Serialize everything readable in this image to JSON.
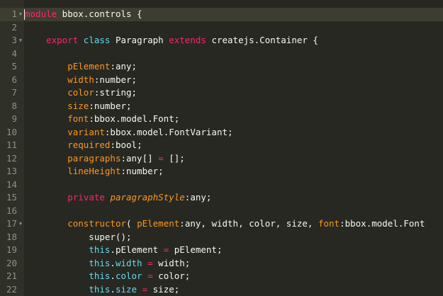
{
  "editor": {
    "lines": [
      {
        "num": "1",
        "fold": true,
        "active": true,
        "tokens": [
          {
            "t": "module",
            "c": "kw"
          },
          {
            "t": " bbox.controls {",
            "c": "plain"
          }
        ]
      },
      {
        "num": "2",
        "tokens": []
      },
      {
        "num": "3",
        "fold": true,
        "tokens": [
          {
            "t": "    ",
            "c": "plain"
          },
          {
            "t": "export",
            "c": "kw"
          },
          {
            "t": " ",
            "c": "plain"
          },
          {
            "t": "class",
            "c": "kw2"
          },
          {
            "t": " Paragraph ",
            "c": "plain"
          },
          {
            "t": "extends",
            "c": "kw"
          },
          {
            "t": " createjs.Container {",
            "c": "plain"
          }
        ]
      },
      {
        "num": "4",
        "tokens": []
      },
      {
        "num": "5",
        "tokens": [
          {
            "t": "        ",
            "c": "plain"
          },
          {
            "t": "pElement",
            "c": "var"
          },
          {
            "t": ":any;",
            "c": "plain"
          }
        ]
      },
      {
        "num": "6",
        "tokens": [
          {
            "t": "        ",
            "c": "plain"
          },
          {
            "t": "width",
            "c": "var"
          },
          {
            "t": ":number;",
            "c": "plain"
          }
        ]
      },
      {
        "num": "7",
        "tokens": [
          {
            "t": "        ",
            "c": "plain"
          },
          {
            "t": "color",
            "c": "var"
          },
          {
            "t": ":string;",
            "c": "plain"
          }
        ]
      },
      {
        "num": "8",
        "tokens": [
          {
            "t": "        ",
            "c": "plain"
          },
          {
            "t": "size",
            "c": "var"
          },
          {
            "t": ":number;",
            "c": "plain"
          }
        ]
      },
      {
        "num": "9",
        "tokens": [
          {
            "t": "        ",
            "c": "plain"
          },
          {
            "t": "font",
            "c": "var"
          },
          {
            "t": ":bbox.model.Font;",
            "c": "plain"
          }
        ]
      },
      {
        "num": "10",
        "tokens": [
          {
            "t": "        ",
            "c": "plain"
          },
          {
            "t": "variant",
            "c": "var"
          },
          {
            "t": ":bbox.model.FontVariant;",
            "c": "plain"
          }
        ]
      },
      {
        "num": "11",
        "tokens": [
          {
            "t": "        ",
            "c": "plain"
          },
          {
            "t": "required",
            "c": "var"
          },
          {
            "t": ":bool;",
            "c": "plain"
          }
        ]
      },
      {
        "num": "12",
        "tokens": [
          {
            "t": "        ",
            "c": "plain"
          },
          {
            "t": "paragraphs",
            "c": "var"
          },
          {
            "t": ":any[] ",
            "c": "plain"
          },
          {
            "t": "=",
            "c": "kw"
          },
          {
            "t": " [];",
            "c": "plain"
          }
        ]
      },
      {
        "num": "13",
        "tokens": [
          {
            "t": "        ",
            "c": "plain"
          },
          {
            "t": "lineHeight",
            "c": "var"
          },
          {
            "t": ":number;",
            "c": "plain"
          }
        ]
      },
      {
        "num": "14",
        "tokens": []
      },
      {
        "num": "15",
        "tokens": [
          {
            "t": "        ",
            "c": "plain"
          },
          {
            "t": "private",
            "c": "kw"
          },
          {
            "t": " ",
            "c": "plain"
          },
          {
            "t": "paragraphStyle",
            "c": "varital"
          },
          {
            "t": ":any;",
            "c": "plain"
          }
        ]
      },
      {
        "num": "16",
        "tokens": []
      },
      {
        "num": "17",
        "fold": true,
        "tokens": [
          {
            "t": "        ",
            "c": "plain"
          },
          {
            "t": "constructor",
            "c": "var"
          },
          {
            "t": "( ",
            "c": "plain"
          },
          {
            "t": "pElement",
            "c": "var"
          },
          {
            "t": ":any, width, color, size, ",
            "c": "plain"
          },
          {
            "t": "font",
            "c": "var"
          },
          {
            "t": ":bbox.model.Font",
            "c": "plain"
          }
        ]
      },
      {
        "num": "18",
        "tokens": [
          {
            "t": "            super();",
            "c": "plain"
          }
        ]
      },
      {
        "num": "19",
        "tokens": [
          {
            "t": "            ",
            "c": "plain"
          },
          {
            "t": "this",
            "c": "kw2"
          },
          {
            "t": ".pElement ",
            "c": "plain"
          },
          {
            "t": "=",
            "c": "kw"
          },
          {
            "t": " pElement;",
            "c": "plain"
          }
        ]
      },
      {
        "num": "20",
        "tokens": [
          {
            "t": "            ",
            "c": "plain"
          },
          {
            "t": "this",
            "c": "kw2"
          },
          {
            "t": ".",
            "c": "plain"
          },
          {
            "t": "width",
            "c": "kw2"
          },
          {
            "t": " ",
            "c": "plain"
          },
          {
            "t": "=",
            "c": "kw"
          },
          {
            "t": " width;",
            "c": "plain"
          }
        ]
      },
      {
        "num": "21",
        "tokens": [
          {
            "t": "            ",
            "c": "plain"
          },
          {
            "t": "this",
            "c": "kw2"
          },
          {
            "t": ".",
            "c": "plain"
          },
          {
            "t": "color",
            "c": "kw2"
          },
          {
            "t": " ",
            "c": "plain"
          },
          {
            "t": "=",
            "c": "kw"
          },
          {
            "t": " color;",
            "c": "plain"
          }
        ]
      },
      {
        "num": "22",
        "tokens": [
          {
            "t": "            ",
            "c": "plain"
          },
          {
            "t": "this",
            "c": "kw2"
          },
          {
            "t": ".",
            "c": "plain"
          },
          {
            "t": "size",
            "c": "kw2"
          },
          {
            "t": " ",
            "c": "plain"
          },
          {
            "t": "=",
            "c": "kw"
          },
          {
            "t": " size;",
            "c": "plain"
          }
        ]
      }
    ]
  },
  "theme": {
    "background": "#272822",
    "gutter": "#2f3129",
    "active_line": "#3e3d32",
    "keyword": "#f92672",
    "storage": "#66d9ef",
    "variable": "#fd971f",
    "text": "#f8f8f2",
    "line_number": "#8f908a"
  },
  "icons": {
    "fold": "fold-arrow-icon"
  }
}
